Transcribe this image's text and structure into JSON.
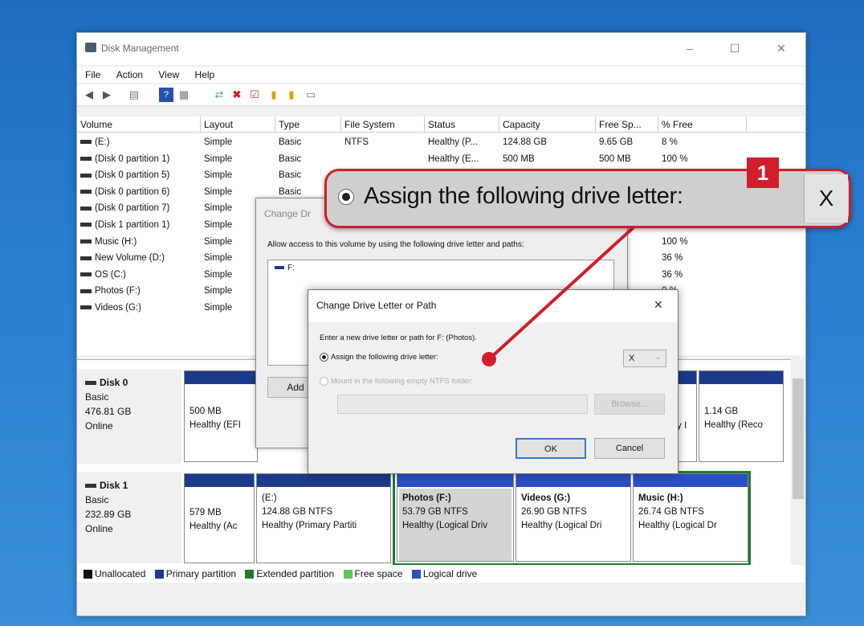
{
  "window": {
    "title": "Disk Management",
    "minimize": "–",
    "maximize": "☐",
    "close": "✕"
  },
  "menu": [
    "File",
    "Action",
    "View",
    "Help"
  ],
  "toolbar": [
    "back-icon",
    "forward-icon",
    "console-tree-icon",
    "help-icon",
    "properties-icon",
    "connect-icon",
    "delete-icon",
    "check-icon",
    "folder-icon",
    "open-icon",
    "view-icon"
  ],
  "table": {
    "columns": [
      "Volume",
      "Layout",
      "Type",
      "File System",
      "Status",
      "Capacity",
      "Free Sp...",
      "% Free"
    ],
    "rows": [
      [
        "(E:)",
        "Simple",
        "Basic",
        "NTFS",
        "Healthy (P...",
        "124.88 GB",
        "9.65 GB",
        "8 %"
      ],
      [
        "(Disk 0 partition 1)",
        "Simple",
        "Basic",
        "",
        "Healthy (E...",
        "500 MB",
        "500 MB",
        "100 %"
      ],
      [
        "(Disk 0 partition 5)",
        "Simple",
        "Basic",
        "",
        "",
        "",
        "",
        ""
      ],
      [
        "(Disk 0 partition 6)",
        "Simple",
        "Basic",
        "",
        "",
        "",
        "",
        ""
      ],
      [
        "(Disk 0 partition 7)",
        "Simple",
        "",
        "",
        "",
        "",
        "",
        ""
      ],
      [
        "(Disk 1 partition 1)",
        "Simple",
        "",
        "",
        "",
        "",
        "",
        ""
      ],
      [
        "Music (H:)",
        "Simple",
        "",
        "",
        "",
        "",
        "GB",
        "100 %"
      ],
      [
        "New Volume (D:)",
        "Simple",
        "",
        "",
        "",
        "",
        "B",
        "36 %"
      ],
      [
        "OS (C:)",
        "Simple",
        "",
        "",
        "",
        "",
        "9 GB",
        "36 %"
      ],
      [
        "Photos (F:)",
        "Simple",
        "",
        "",
        "",
        "",
        "",
        "0 %"
      ],
      [
        "Videos (G:)",
        "Simple",
        "",
        "",
        "",
        "",
        "",
        "0 %"
      ]
    ]
  },
  "disks": [
    {
      "name": "Disk 0",
      "type": "Basic",
      "size": "476.81 GB",
      "state": "Online",
      "parts": [
        {
          "l1": "500 MB",
          "l2": "Healthy (EFI"
        },
        {
          "l1": "1.14 GB",
          "l2": "Healthy (Reco"
        },
        {
          "l1": "",
          "l2": "y I"
        }
      ]
    },
    {
      "name": "Disk 1",
      "type": "Basic",
      "size": "232.89 GB",
      "state": "Online",
      "parts": [
        {
          "l0": "",
          "l1": "579 MB",
          "l2": "Healthy (Ac"
        },
        {
          "l0": "(E:)",
          "l1": "124.88 GB NTFS",
          "l2": "Healthy (Primary Partiti"
        },
        {
          "l0": "Photos  (F:)",
          "l1": "53.79 GB NTFS",
          "l2": "Healthy (Logical Driv"
        },
        {
          "l0": "Videos  (G:)",
          "l1": "26.90 GB NTFS",
          "l2": "Healthy (Logical Dri"
        },
        {
          "l0": "Music  (H:)",
          "l1": "26.74 GB NTFS",
          "l2": "Healthy (Logical Dr"
        }
      ]
    }
  ],
  "legend": [
    {
      "label": "Unallocated",
      "color": "#111111"
    },
    {
      "label": "Primary partition",
      "color": "#1b3a8a"
    },
    {
      "label": "Extended partition",
      "color": "#1e7b34"
    },
    {
      "label": "Free space",
      "color": "#5fc35f"
    },
    {
      "label": "Logical drive",
      "color": "#2b4fc7"
    }
  ],
  "back_dialog": {
    "title": "Change Dr",
    "desc": "Allow access to this volume by using the following drive letter and paths:",
    "list_item": "F:",
    "add": "Add"
  },
  "dialog": {
    "title": "Change Drive Letter or Path",
    "close": "✕",
    "prompt": "Enter a new drive letter or path for F: (Photos).",
    "assign": "Assign the following drive letter:",
    "letter": "X",
    "mount": "Mount in the following empty NTFS folder:",
    "browse": "Browse...",
    "ok": "OK",
    "cancel": "Cancel"
  },
  "callout": {
    "badge": "1",
    "text": "Assign the following drive letter:",
    "letter": "X"
  },
  "colors": {
    "accent": "#d11d2c",
    "primary": "#1b3a8a",
    "extended": "#1e7b34"
  }
}
